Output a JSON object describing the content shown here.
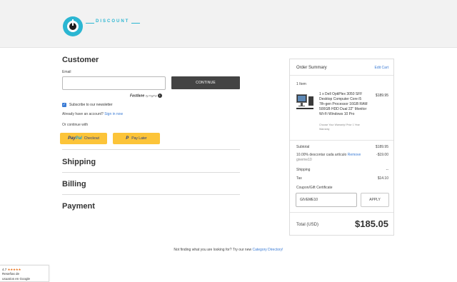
{
  "brand": {
    "logo_top": "DISCOUNT"
  },
  "customer": {
    "heading": "Customer",
    "email_label": "Email",
    "email_value": "",
    "continue_label": "CONTINUE",
    "fastlane_label": "Fastlane",
    "fastlane_by": "by PayPal",
    "subscribe_label": "Subscribe to our newsletter",
    "subscribe_checked": true,
    "account_prompt": "Already have an account?",
    "sign_in_link": "Sign in now",
    "or_continue": "Or continue with",
    "paypal_button": {
      "brand_pay": "Pay",
      "brand_pal": "Pal",
      "label": "Checkout"
    },
    "paylater_button": {
      "label": "Pay Later"
    }
  },
  "sections": {
    "shipping": "Shipping",
    "billing": "Billing",
    "payment": "Payment"
  },
  "order_summary": {
    "title": "Order Summary",
    "edit_cart": "Edit Cart",
    "items_count": "1 Item",
    "product": {
      "name": "1 x Dell OptiPlex 3050 SFF Desktop Computer Core i5 7th-gen Processor 16GB RAM 500GB HDD Dual 22\" Monitor Wi-Fi Windows 10 Pro",
      "option": "Choose Your Warranty! Prior 1 Year Warranty",
      "price": "$189.95"
    },
    "subtotal_label": "Subtotal",
    "subtotal_value": "$189.95",
    "discount_label": "10.00% descontar cada artículo",
    "remove_link": "Remove",
    "coupon_code_applied": "giveme10",
    "discount_value": "-$19.00",
    "shipping_label": "Shipping",
    "shipping_value": "--",
    "tax_label": "Tax",
    "tax_value": "$14.10",
    "coupon_label": "Coupon/Gift Certificate",
    "coupon_input_value": "GIVEME10",
    "apply_label": "APPLY",
    "total_label": "Total (USD)",
    "total_value": "$185.05"
  },
  "footer": {
    "prompt": "Not finding what you are looking for? Try our new",
    "link": "Category Directory!"
  },
  "review_badge": {
    "rating": "4.7",
    "stars": "★★★★★",
    "line1": "Reseñas de",
    "line2": "usuarios en Google"
  }
}
